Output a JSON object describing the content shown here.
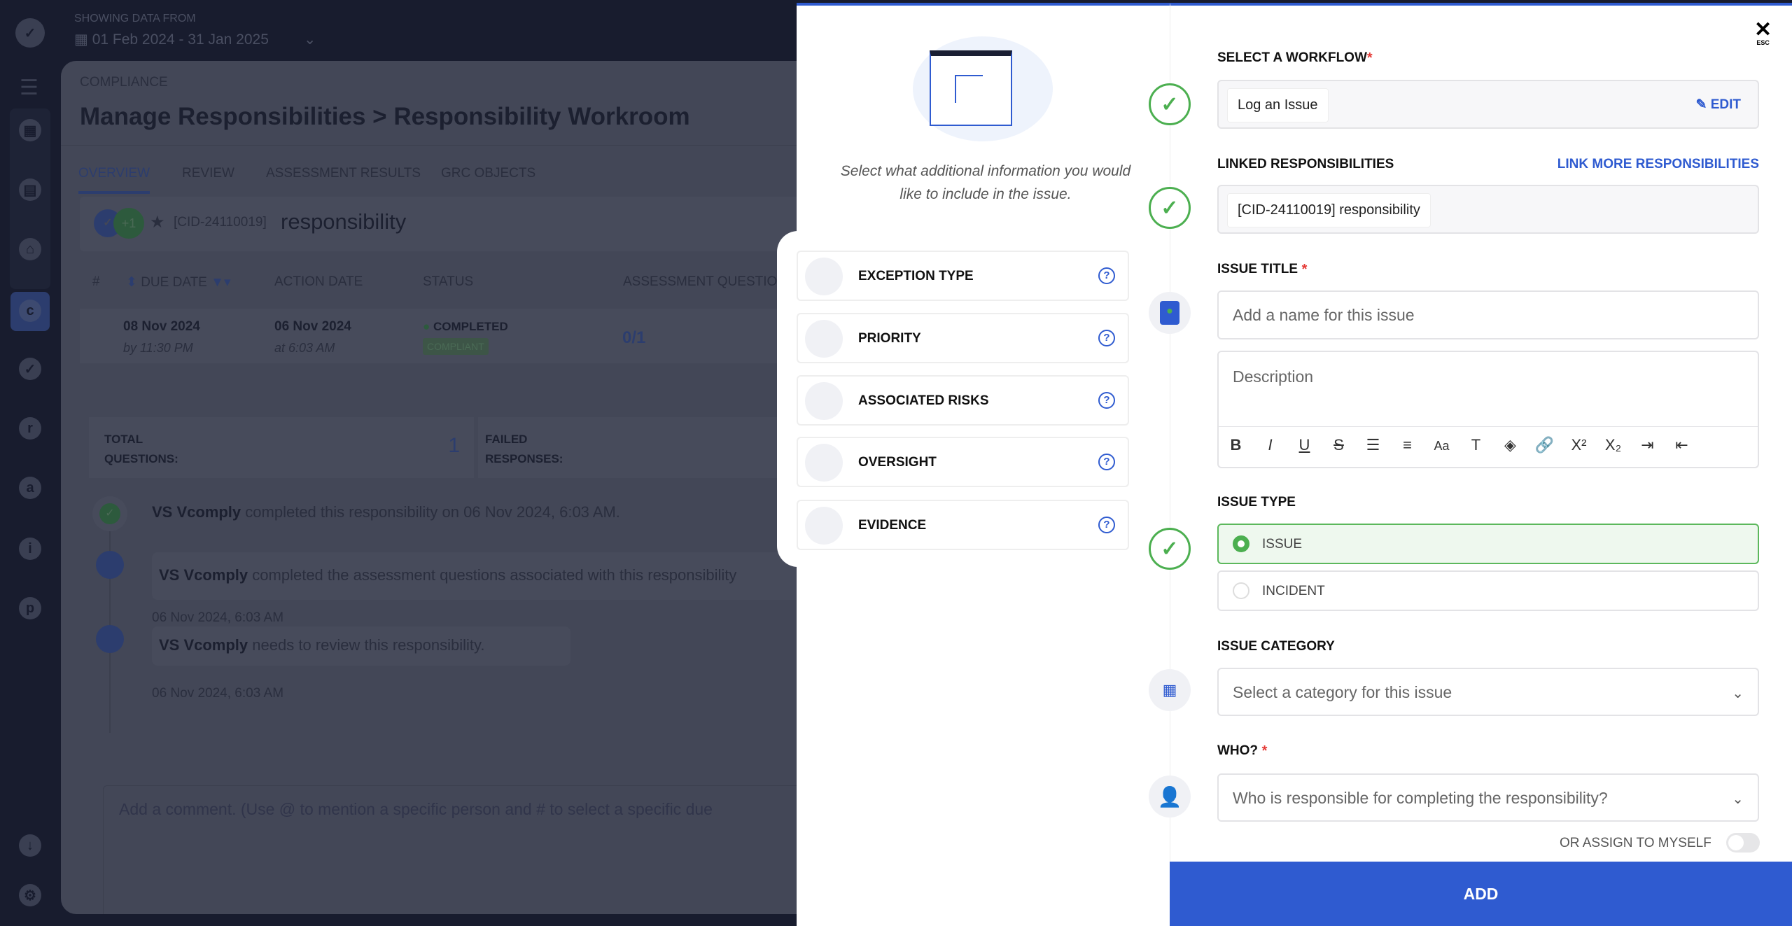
{
  "header": {
    "showing_label": "SHOWING DATA FROM",
    "date_range": "01 Feb 2024 - 31 Jan 2025"
  },
  "page": {
    "section": "COMPLIANCE",
    "title": "Manage Responsibilities > Responsibility Workroom"
  },
  "tabs": [
    "OVERVIEW",
    "REVIEW",
    "ASSESSMENT RESULTS",
    "GRC OBJECTS"
  ],
  "responsibility": {
    "avatar_extra": "+1",
    "cid": "[CID-24110019]",
    "name": "responsibility"
  },
  "table": {
    "headers": [
      "#",
      "DUE DATE",
      "ACTION DATE",
      "STATUS",
      "ASSESSMENT QUESTION"
    ],
    "row": {
      "due_date": "08 Nov 2024",
      "due_time": "by 11:30 PM",
      "action_date": "06 Nov 2024",
      "action_time": "at 6:03 AM",
      "status": "COMPLETED",
      "badge": "COMPLIANT",
      "assessment": "0/1"
    }
  },
  "stats": {
    "total_label": "TOTAL QUESTIONS:",
    "total_value": "1",
    "failed_label": "FAILED RESPONSES:"
  },
  "timeline": [
    {
      "user": "VS Vcomply",
      "text": "completed this responsibility on 06 Nov 2024, 6:03 AM."
    },
    {
      "user": "VS Vcomply",
      "text": "completed the assessment questions associated with this responsibility",
      "date": "06 Nov 2024, 6:03 AM"
    },
    {
      "user": "VS Vcomply",
      "text": "needs to review this responsibility.",
      "date": "06 Nov 2024, 6:03 AM"
    }
  ],
  "comment_placeholder": "Add a comment. (Use @ to mention a specific person and # to select a specific due",
  "panel": {
    "intro": "Select what additional information you would like to include in the issue.",
    "options": [
      "EXCEPTION TYPE",
      "PRIORITY",
      "ASSOCIATED RISKS",
      "OVERSIGHT",
      "EVIDENCE"
    ],
    "close_hint": "ESC",
    "workflow_label": "SELECT A WORKFLOW",
    "workflow_value": "Log an Issue",
    "edit": "EDIT",
    "linked_label": "LINKED RESPONSIBILITIES",
    "link_more": "LINK MORE RESPONSIBILITIES",
    "linked_value": "[CID-24110019] responsibility",
    "title_label": "ISSUE TITLE",
    "title_placeholder": "Add a name for this issue",
    "description_placeholder": "Description",
    "type_label": "ISSUE TYPE",
    "type_options": [
      "ISSUE",
      "INCIDENT"
    ],
    "type_selected": "ISSUE",
    "category_label": "ISSUE CATEGORY",
    "category_placeholder": "Select a category for this issue",
    "who_label": "WHO?",
    "who_placeholder": "Who is responsible for completing the responsibility?",
    "assign_myself": "OR ASSIGN TO MYSELF",
    "assign_myself_on": false,
    "add": "ADD",
    "accent": "#2f5bd0",
    "success": "#4caf50"
  }
}
